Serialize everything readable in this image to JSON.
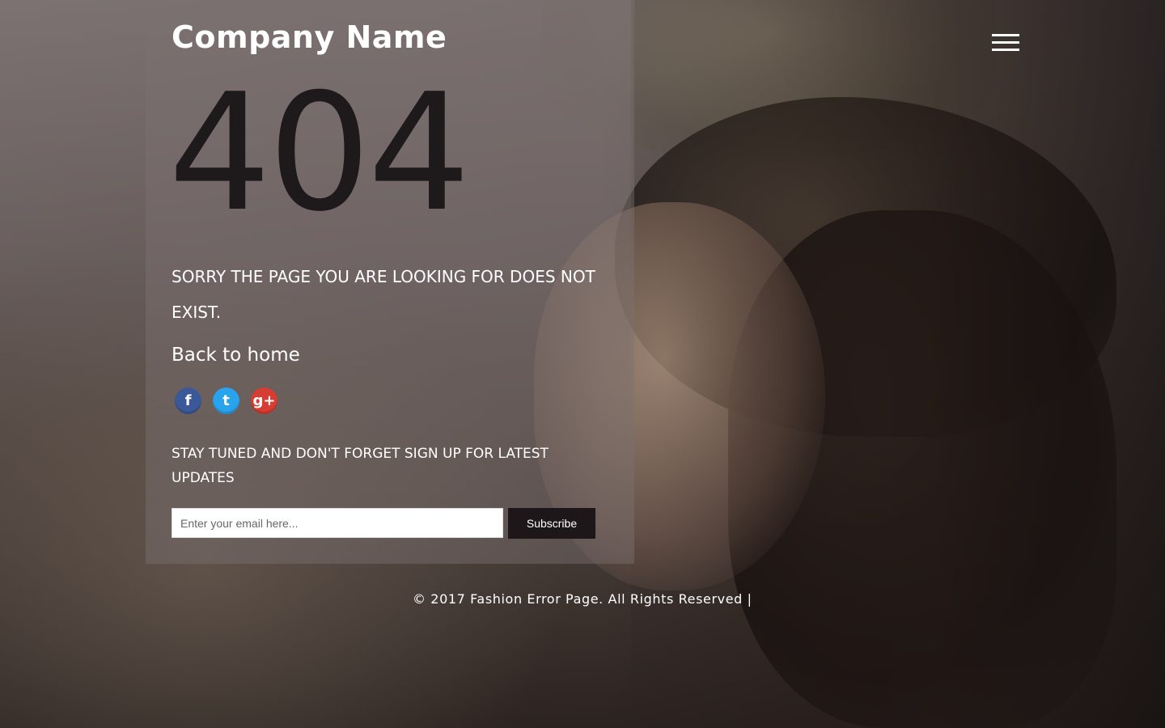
{
  "header": {
    "company_name": "Company Name"
  },
  "error": {
    "code": "404",
    "message": "SORRY THE PAGE YOU ARE LOOKING FOR DOES NOT EXIST.",
    "back_link_label": "Back to home"
  },
  "social": [
    {
      "name": "facebook-icon",
      "glyph": "f",
      "color": "#3b5998"
    },
    {
      "name": "twitter-icon",
      "glyph": "t",
      "color": "#2aa3ef"
    },
    {
      "name": "google-plus-icon",
      "glyph": "g+",
      "color": "#d73d32"
    }
  ],
  "newsletter": {
    "text": "STAY TUNED AND DON'T FORGET SIGN UP FOR LATEST UPDATES",
    "email_placeholder": "Enter your email here...",
    "subscribe_label": "Subscribe"
  },
  "footer": {
    "copyright": "© 2017 Fashion Error Page. All Rights Reserved |"
  }
}
